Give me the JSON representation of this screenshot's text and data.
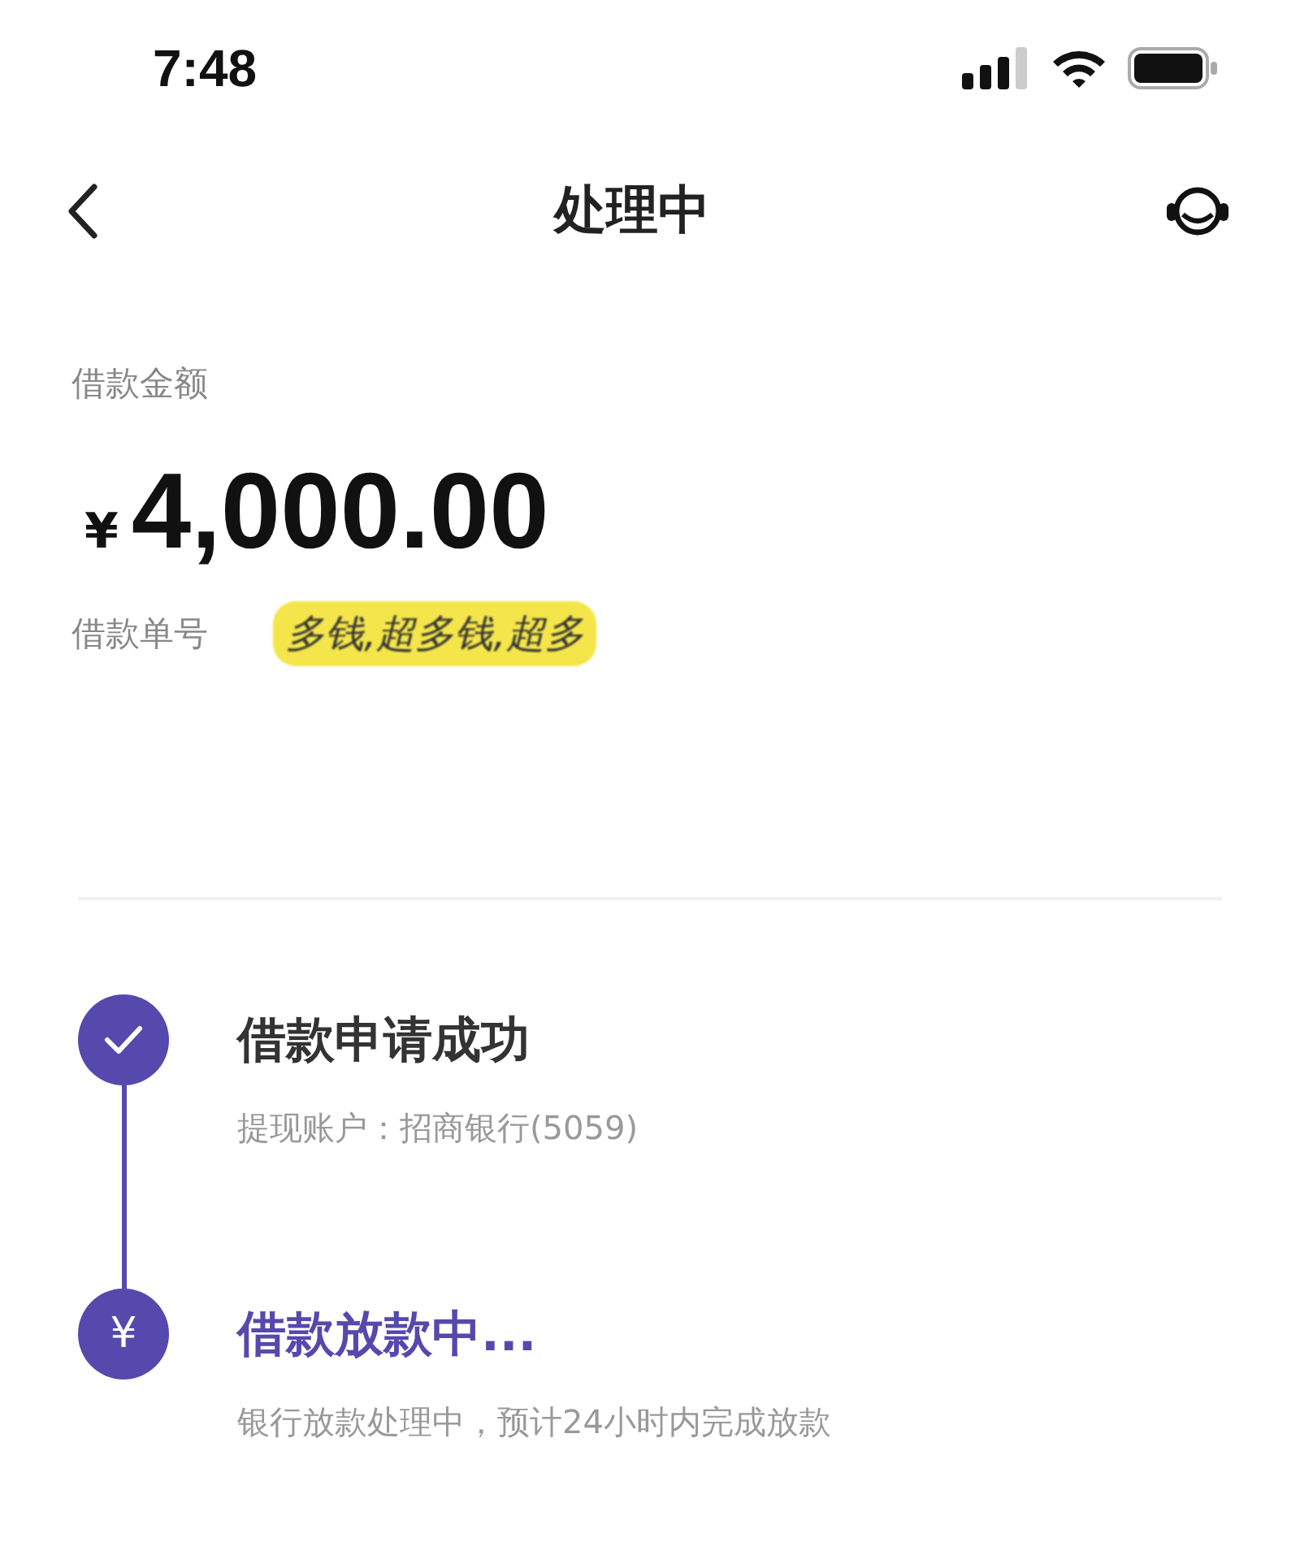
{
  "status_bar": {
    "time": "7:48"
  },
  "nav": {
    "title": "处理中"
  },
  "loan": {
    "amount_label": "借款金额",
    "currency": "¥",
    "amount": "4,000.00",
    "number_label": "借款单号",
    "number_scribble": "多钱,超多钱,超多"
  },
  "steps": [
    {
      "kind": "done",
      "title": "借款申请成功",
      "detail": "提现账户：招商银行(5059)"
    },
    {
      "kind": "active",
      "symbol": "¥",
      "title": "借款放款中...",
      "detail": "银行放款处理中，预计24小时内完成放款"
    }
  ]
}
